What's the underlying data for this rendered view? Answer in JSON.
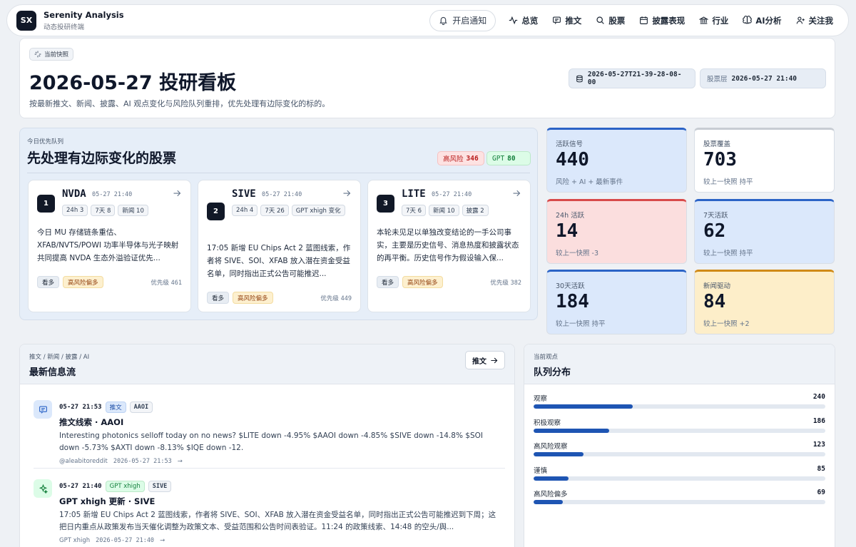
{
  "nav": {
    "logo": "SX",
    "brand_title": "Serenity Analysis",
    "brand_sub": "动态投研终端",
    "notify_label": "开启通知",
    "items": [
      {
        "label": "总览",
        "icon": "pulse-icon"
      },
      {
        "label": "推文",
        "icon": "message-icon"
      },
      {
        "label": "股票",
        "icon": "search-icon"
      },
      {
        "label": "披露表现",
        "icon": "calendar-icon"
      },
      {
        "label": "行业",
        "icon": "bank-icon"
      },
      {
        "label": "AI分析",
        "icon": "brain-icon"
      },
      {
        "label": "关注我",
        "icon": "user-plus-icon"
      }
    ]
  },
  "hero": {
    "chip": "当前快照",
    "title": "2026-05-27 投研看板",
    "subtitle": "按最新推文、新闻、披露、AI 观点变化与风险队列重排，优先处理有边际变化的标的。",
    "snapshot_id": "2026-05-27T21-39-28-08-00",
    "stock_layer_label": "股票层",
    "stock_layer_time": "2026-05-27 21:40"
  },
  "queue": {
    "kicker": "今日优先队列",
    "title": "先处理有边际变化的股票",
    "risk_label": "高风险",
    "risk_count": "346",
    "gpt_label": "GPT",
    "gpt_count": "80",
    "cards": [
      {
        "rank": "1",
        "ticker": "NVDA",
        "time": "05-27 21:40",
        "tags": [
          "24h 3",
          "7天 8",
          "新闻 10"
        ],
        "body": "今日 MU 存储链条重估、XFAB/NVTS/POWI 功率半导体与光子映射共同提高 NVDA 生态外溢验证优先...",
        "view": "看多",
        "risk": "高风险偏多",
        "prio_label": "优先级",
        "prio": "461"
      },
      {
        "rank": "2",
        "ticker": "SIVE",
        "time": "05-27 21:40",
        "tags": [
          "24h 4",
          "7天 26",
          "GPT xhigh 变化"
        ],
        "body": "17:05 新增 EU Chips Act 2 蓝图线索，作者将 SIVE、SOI、XFAB 放入潜在资金受益名单，同时指出正式公告可能推迟...",
        "view": "看多",
        "risk": "高风险偏多",
        "prio_label": "优先级",
        "prio": "449"
      },
      {
        "rank": "3",
        "ticker": "LITE",
        "time": "05-27 21:40",
        "tags": [
          "7天 6",
          "新闻 10",
          "披露 2"
        ],
        "body": "本轮未见足以单独改变结论的一手公司事实，主要是历史信号、消息热度和披露状态的再平衡。历史信号作为假设输入保...",
        "view": "看多",
        "risk": "高风险偏多",
        "prio_label": "优先级",
        "prio": "382"
      }
    ]
  },
  "stats": [
    {
      "label": "活跃信号",
      "value": "440",
      "sub": "风险 + AI + 最新事件",
      "bg": "#dbe8fb",
      "top": "#2b63c6"
    },
    {
      "label": "股票覆盖",
      "value": "703",
      "sub": "较上一快照 持平",
      "bg": "#ffffff",
      "top": "#c7ccd3"
    },
    {
      "label": "24h 活跃",
      "value": "14",
      "sub": "较上一快照 -3",
      "bg": "#fbdede",
      "top": "#d84a4a"
    },
    {
      "label": "7天活跃",
      "value": "62",
      "sub": "较上一快照 持平",
      "bg": "#dbe8fb",
      "top": "#2b63c6"
    },
    {
      "label": "30天活跃",
      "value": "184",
      "sub": "较上一快照 持平",
      "bg": "#dbe8fb",
      "top": "#2b63c6"
    },
    {
      "label": "新闻驱动",
      "value": "84",
      "sub": "较上一快照 +2",
      "bg": "#fdeec9",
      "top": "#d08a17"
    }
  ],
  "feed": {
    "kicker": "推文 / 新闻 / 披露 / AI",
    "title": "最新信息流",
    "button": "推文",
    "items": [
      {
        "time": "05-27 21:53",
        "type": "推文",
        "ticker": "AAOI",
        "title": "推文线索 · AAOI",
        "body": "Interesting photonics selloff today on no news? $LITE down -4.95% $AAOI down -4.85% $SIVE down -14.8% $SOI down -5.73% $AXTI down -8.13% $IQE down -12.",
        "source": "@aleabitoreddit",
        "stamp": "2026-05-27 21:53"
      },
      {
        "time": "05-27 21:40",
        "type": "GPT xhigh",
        "ticker": "SIVE",
        "title": "GPT xhigh 更新 · SIVE",
        "body": "17:05 新增 EU Chips Act 2 蓝图线索，作者将 SIVE、SOI、XFAB 放入潜在资金受益名单，同时指出正式公告可能推迟到下周；这把日内重点从政策发布当天催化调整为政策文本、受益范围和公告时间表验证。11:24 的政策线索、14:48 的空头/舆...",
        "source": "GPT xhigh",
        "stamp": "2026-05-27 21:40"
      }
    ]
  },
  "dist": {
    "kicker": "当前观点",
    "title": "队列分布",
    "rows": [
      {
        "label": "观察",
        "value": "240",
        "fraction": 0.34
      },
      {
        "label": "积极观察",
        "value": "186",
        "fraction": 0.26
      },
      {
        "label": "高风险观察",
        "value": "123",
        "fraction": 0.17
      },
      {
        "label": "谨慎",
        "value": "85",
        "fraction": 0.12
      },
      {
        "label": "高风险偏多",
        "value": "69",
        "fraction": 0.1
      }
    ]
  }
}
